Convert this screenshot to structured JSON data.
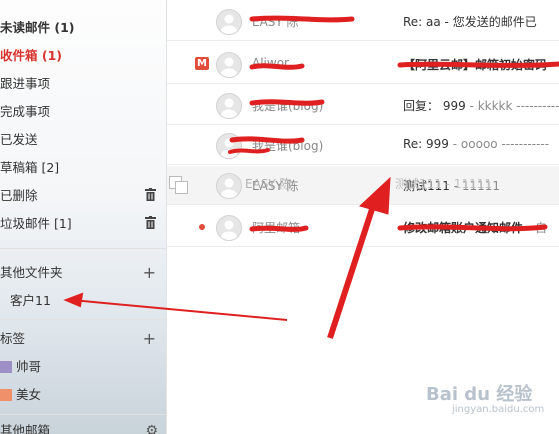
{
  "sidebar": {
    "items": [
      {
        "label": "未读邮件 (1)",
        "style": "bold"
      },
      {
        "label": "收件箱 (1)",
        "style": "red"
      },
      {
        "label": "跟进事项"
      },
      {
        "label": "完成事项"
      },
      {
        "label": "已发送"
      },
      {
        "label": "草稿箱 [2]"
      },
      {
        "label": "已删除",
        "icon": "trash-icon"
      },
      {
        "label": "垃圾邮件 [1]",
        "icon": "trash-icon"
      }
    ],
    "other_folders": {
      "label": "其他文件夹",
      "icon": "plus-icon"
    },
    "folder_child": {
      "label": "客户11"
    },
    "tags": {
      "label": "标签",
      "icon": "plus-icon"
    },
    "tag_items": [
      {
        "label": "帅哥",
        "color": "#9b8fc6"
      },
      {
        "label": "美女",
        "color": "#f0906a"
      }
    ],
    "other_mailbox": {
      "label": "其他邮箱",
      "icon": "gear-icon"
    }
  },
  "mail_list": {
    "rows": [
      {
        "sender": "EASY 陈",
        "subject": "Re: aa - 您发送的邮件已"
      },
      {
        "sender": "Aliwor",
        "subject": "【阿里云邮】邮箱初始密码",
        "icon": "m-icon"
      },
      {
        "sender": "我是谁(blog)",
        "subject": "回复： 999",
        "preview": " - kkkkk -----------"
      },
      {
        "sender": "我是谁(blog)",
        "subject": "Re: 999",
        "preview": " - ooooo -----------"
      },
      {
        "sender": "EASY 陈",
        "subject": "测试111",
        "preview": " - 11111"
      },
      {
        "sender": "阿里邮箱",
        "subject": "修改邮箱账户通知邮件",
        "preview": " - 自",
        "unread": true
      }
    ],
    "drag_ghost": {
      "sender": "EASY 陈",
      "subject": "测试111 - 11111"
    }
  },
  "watermark": {
    "text": "Bai du 经验",
    "sub": "jingyan.baidu.com"
  },
  "colors": {
    "accent_red": "#d9332e",
    "arrow_red": "#e02020"
  }
}
